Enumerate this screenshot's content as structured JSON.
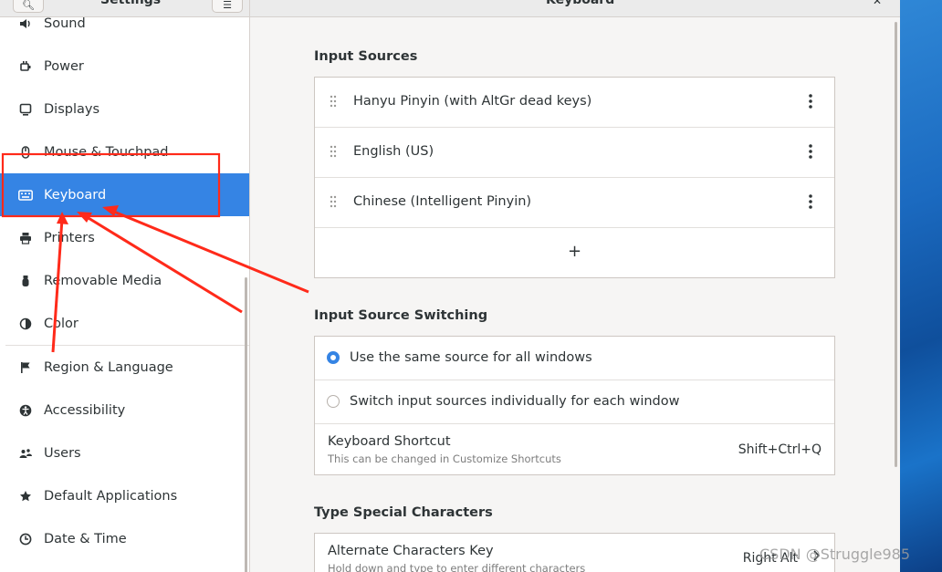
{
  "window": {
    "sidebar_title": "Settings",
    "main_title": "Keyboard"
  },
  "sidebar": {
    "items": [
      {
        "label": "Sound",
        "icon": "speaker-icon"
      },
      {
        "label": "Power",
        "icon": "power-icon"
      },
      {
        "label": "Displays",
        "icon": "display-icon"
      },
      {
        "label": "Mouse & Touchpad",
        "icon": "mouse-icon"
      },
      {
        "label": "Keyboard",
        "icon": "keyboard-icon",
        "selected": true
      },
      {
        "label": "Printers",
        "icon": "printer-icon"
      },
      {
        "label": "Removable Media",
        "icon": "usb-icon"
      },
      {
        "label": "Color",
        "icon": "color-icon"
      },
      {
        "label": "Region & Language",
        "icon": "flag-icon"
      },
      {
        "label": "Accessibility",
        "icon": "accessibility-icon"
      },
      {
        "label": "Users",
        "icon": "users-icon"
      },
      {
        "label": "Default Applications",
        "icon": "star-icon"
      },
      {
        "label": "Date & Time",
        "icon": "clock-icon"
      }
    ]
  },
  "input_sources": {
    "title": "Input Sources",
    "items": [
      {
        "label": "Hanyu Pinyin (with AltGr dead keys)"
      },
      {
        "label": "English (US)"
      },
      {
        "label": "Chinese (Intelligent Pinyin)"
      }
    ],
    "add_label": "+"
  },
  "switching": {
    "title": "Input Source Switching",
    "option_same": "Use the same source for all windows",
    "option_individual": "Switch input sources individually for each window",
    "selected": "same",
    "shortcut_title": "Keyboard Shortcut",
    "shortcut_subtitle": "This can be changed in Customize Shortcuts",
    "shortcut_value": "Shift+Ctrl+Q"
  },
  "special_chars": {
    "title": "Type Special Characters",
    "alt_key_title": "Alternate Characters Key",
    "alt_key_subtitle": "Hold down and type to enter different characters",
    "alt_key_value": "Right Alt"
  },
  "watermark": "CSDN @Struggle985",
  "colors": {
    "accent": "#3584e4",
    "annotation": "#ff2a1a"
  }
}
